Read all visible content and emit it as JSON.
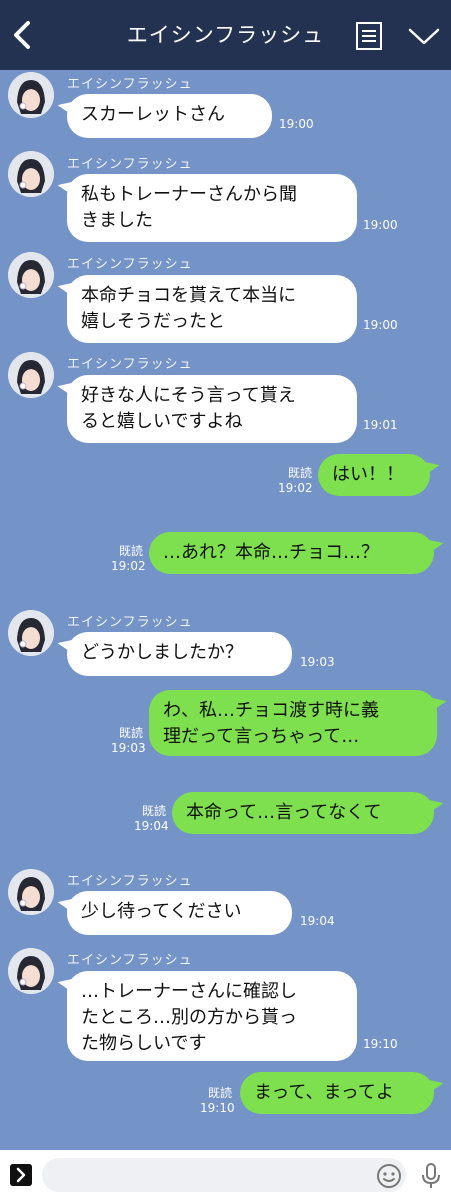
{
  "header": {
    "title": "エイシンフラッシュ"
  },
  "colors": {
    "header_bg": "#233250",
    "chat_bg": "#7493c6",
    "incoming_bubble": "#ffffff",
    "outgoing_bubble": "#7fe04f"
  },
  "messages": [
    {
      "dir": "in",
      "name": "エイシンフラッシュ",
      "text": "スカーレットさん",
      "time": "19:00"
    },
    {
      "dir": "in",
      "name": "エイシンフラッシュ",
      "text": "私もトレーナーさんから聞\nきました",
      "time": "19:00"
    },
    {
      "dir": "in",
      "name": "エイシンフラッシュ",
      "text": "本命チョコを貰えて本当に\n嬉しそうだったと",
      "time": "19:00"
    },
    {
      "dir": "in",
      "name": "エイシンフラッシュ",
      "text": "好きな人にそう言って貰え\nると嬉しいですよね",
      "time": "19:01"
    },
    {
      "dir": "out",
      "read": "既読",
      "text": "はい！！",
      "time": "19:02"
    },
    {
      "dir": "out",
      "read": "既読",
      "text": "…あれ？本命…チョコ…？",
      "time": "19:02"
    },
    {
      "dir": "in",
      "name": "エイシンフラッシュ",
      "text": "どうかしましたか？",
      "time": "19:03"
    },
    {
      "dir": "out",
      "read": "既読",
      "text": "わ、私…チョコ渡す時に義\n理だって言っちゃって…",
      "time": "19:03"
    },
    {
      "dir": "out",
      "read": "既読",
      "text": "本命って…言ってなくて",
      "time": "19:04"
    },
    {
      "dir": "in",
      "name": "エイシンフラッシュ",
      "text": "少し待ってください",
      "time": "19:04"
    },
    {
      "dir": "in",
      "name": "エイシンフラッシュ",
      "text": "…トレーナーさんに確認し\nたところ…別の方から貰っ\nた物らしいです",
      "time": "19:10"
    },
    {
      "dir": "out",
      "read": "既読",
      "text": "まって、まってよ",
      "time": "19:10"
    }
  ],
  "icons": {
    "back": "chevron-left-icon",
    "menu": "list-icon",
    "collapse": "chevron-down-icon",
    "expand": "chevron-right-icon",
    "emoji": "emoji-icon",
    "mic": "microphone-icon"
  }
}
